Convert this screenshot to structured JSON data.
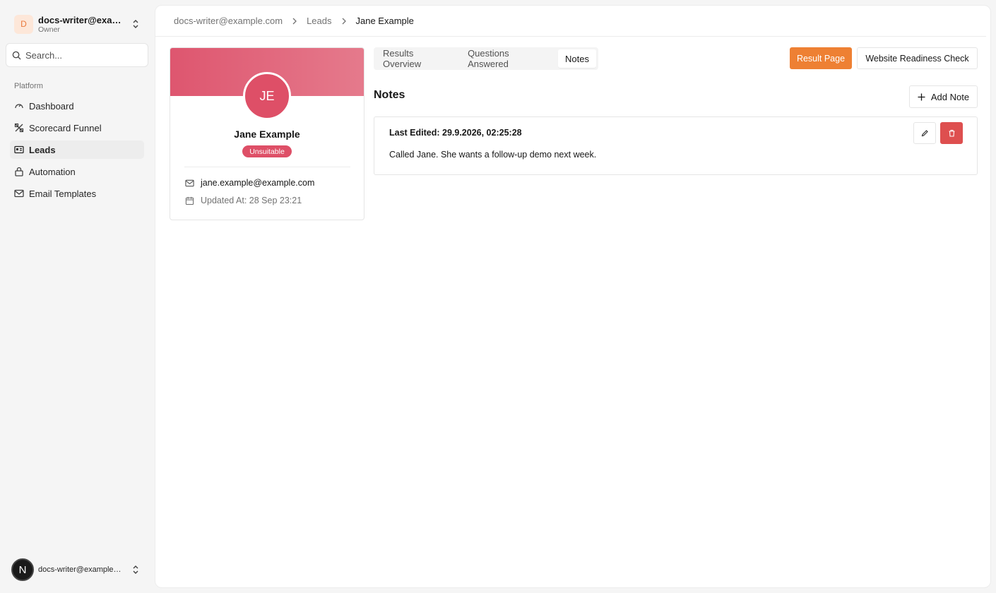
{
  "workspace": {
    "avatar_letter": "D",
    "name": "docs-writer@example.com",
    "role": "Owner"
  },
  "search": {
    "placeholder": "Search..."
  },
  "sidebar": {
    "group_label": "Platform",
    "items": [
      {
        "label": "Dashboard",
        "icon": "gauge-icon",
        "active": false
      },
      {
        "label": "Scorecard Funnel",
        "icon": "funnel-icon",
        "active": false
      },
      {
        "label": "Leads",
        "icon": "id-card-icon",
        "active": true
      },
      {
        "label": "Automation",
        "icon": "lock-icon",
        "active": false
      },
      {
        "label": "Email Templates",
        "icon": "mail-icon",
        "active": false
      }
    ]
  },
  "user": {
    "avatar_letter": "N",
    "email": "docs-writer@example.com"
  },
  "breadcrumb": [
    "docs-writer@example.com",
    "Leads",
    "Jane Example"
  ],
  "profile": {
    "initials": "JE",
    "name": "Jane Example",
    "status": "Unsuitable",
    "email": "jane.example@example.com",
    "updated": "Updated At: 28 Sep 23:21"
  },
  "tabs": [
    {
      "label": "Results Overview",
      "active": false
    },
    {
      "label": "Questions Answered",
      "active": false
    },
    {
      "label": "Notes",
      "active": true
    }
  ],
  "actions": {
    "result_page": "Result Page",
    "readiness_check": "Website Readiness Check"
  },
  "notes": {
    "title": "Notes",
    "add_label": "Add Note",
    "items": [
      {
        "last_edited": "Last Edited: 29.9.2026, 02:25:28",
        "text": "Called Jane. She wants a follow-up demo next week."
      }
    ]
  },
  "colors": {
    "accent_orange": "#ee8033",
    "status_red": "#de4f67",
    "delete_red": "#de4f4f"
  }
}
